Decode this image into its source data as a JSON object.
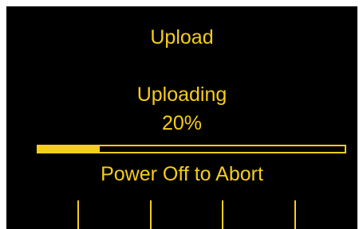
{
  "screen": {
    "title": "Upload",
    "status": "Uploading",
    "percent_text": "20%",
    "progress_fraction": 0.2,
    "hint": "Power Off to Abort"
  },
  "softkeys": [
    "",
    "",
    "",
    "",
    ""
  ],
  "colors": {
    "background": "#000000",
    "foreground": "#f5cd1b",
    "bezel": "#ffffff"
  }
}
